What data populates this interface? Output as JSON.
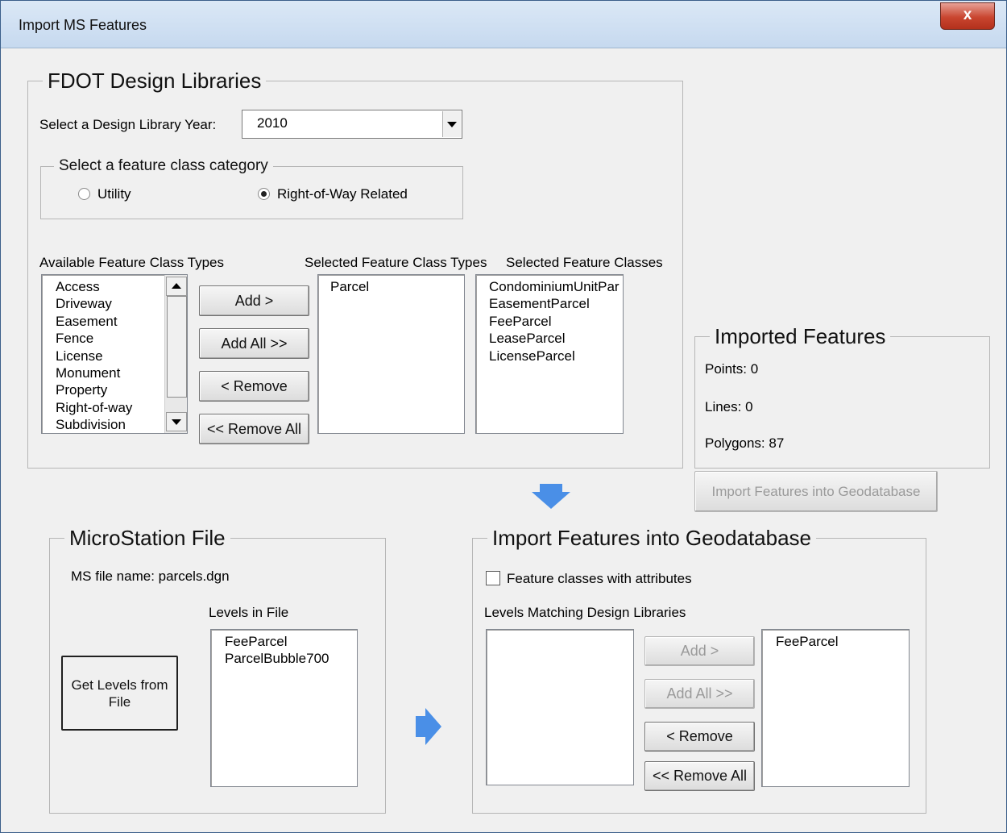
{
  "window": {
    "title": "Import MS Features",
    "close_glyph": "x"
  },
  "design_libraries": {
    "title": "FDOT Design Libraries",
    "year_label": "Select a Design Library Year:",
    "year_value": "2010",
    "category": {
      "title": "Select a feature class category",
      "options": [
        {
          "label": "Utility",
          "selected": false
        },
        {
          "label": "Right-of-Way Related",
          "selected": true
        }
      ]
    },
    "available_label": "Available Feature Class Types",
    "available_items": [
      "Access",
      "Driveway",
      "Easement",
      "Fence",
      "License",
      "Monument",
      "Property",
      "Right-of-way",
      "Subdivision"
    ],
    "buttons": {
      "add": "Add >",
      "add_all": "Add All >>",
      "remove": "< Remove",
      "remove_all": "<< Remove All"
    },
    "selected_types_label": "Selected Feature Class Types",
    "selected_types_items": [
      "Parcel"
    ],
    "selected_classes_label": "Selected Feature Classes",
    "selected_classes_items": [
      "CondominiumUnitPar",
      "EasementParcel",
      "FeeParcel",
      "LeaseParcel",
      "LicenseParcel"
    ]
  },
  "imported_features": {
    "title": "Imported Features",
    "points": "Points: 0",
    "lines": "Lines: 0",
    "polygons": "Polygons: 87",
    "import_button": "Import Features into Geodatabase",
    "import_button_enabled": false
  },
  "microstation": {
    "title": "MicroStation File",
    "file_name": "MS file name: parcels.dgn",
    "levels_label": "Levels in File",
    "levels_items": [
      "FeeParcel",
      "ParcelBubble700"
    ],
    "get_levels_button": "Get Levels from File"
  },
  "import_geodatabase": {
    "title": "Import Features into Geodatabase",
    "checkbox_label": "Feature classes with attributes",
    "checkbox_checked": false,
    "matching_label": "Levels Matching Design Libraries",
    "matching_items": [],
    "target_items": [
      "FeeParcel"
    ],
    "buttons": {
      "add": "Add >",
      "add_all": "Add All >>",
      "remove": "< Remove",
      "remove_all": "<< Remove All"
    },
    "add_enabled": false,
    "add_all_enabled": false
  },
  "icons": [
    "arrow-down-icon",
    "arrow-right-icon",
    "close-icon"
  ],
  "colors": {
    "arrow_blue": "#4a8fe7",
    "close_red": "#c9452f"
  }
}
